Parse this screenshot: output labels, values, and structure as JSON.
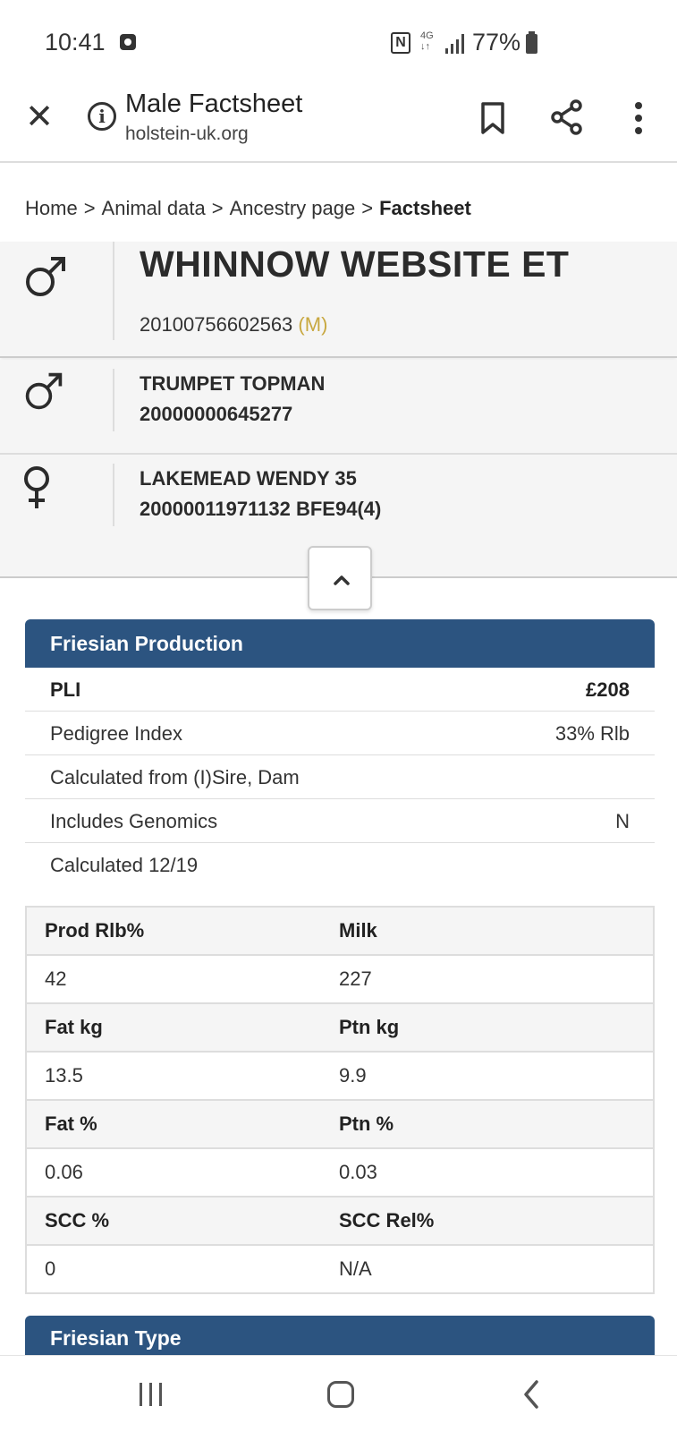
{
  "status_bar": {
    "time": "10:41",
    "network": "4G",
    "battery": "77%",
    "icons": [
      "app-notification-icon",
      "nfc-icon",
      "signal-icon",
      "battery-icon"
    ]
  },
  "browser": {
    "title": "Male Factsheet",
    "url": "holstein-uk.org",
    "icons": [
      "close-icon",
      "info-icon",
      "bookmark-icon",
      "share-icon",
      "more-vertical-icon"
    ]
  },
  "breadcrumb": {
    "items": [
      "Home",
      "Animal data",
      "Ancestry page"
    ],
    "current": "Factsheet",
    "separator": ">"
  },
  "animal": {
    "name": "WHINNOW WEBSITE ET",
    "id": "20100756602563",
    "sex_code": "(M)",
    "sex_icon": "male-icon"
  },
  "parents": {
    "sire": {
      "name": "TRUMPET TOPMAN",
      "id_line": "20000000645277",
      "icon": "male-icon"
    },
    "dam": {
      "name": "LAKEMEAD WENDY 35",
      "id_line": "20000011971132 BFE94(4)",
      "icon": "female-icon"
    }
  },
  "collapse_icon": "chevron-up-icon",
  "production": {
    "title": "Friesian Production",
    "rows": [
      {
        "label": "PLI",
        "value": "£208",
        "bold": true
      },
      {
        "label": "Pedigree Index",
        "value": "33% Rlb"
      },
      {
        "label": "Calculated from (I)Sire, Dam",
        "value": ""
      },
      {
        "label": "Includes Genomics",
        "value": "N"
      },
      {
        "label": "Calculated 12/19",
        "value": ""
      }
    ],
    "table": [
      {
        "h1": "Prod Rlb%",
        "h2": "Milk",
        "v1": "42",
        "v2": "227"
      },
      {
        "h1": "Fat kg",
        "h2": "Ptn kg",
        "v1": "13.5",
        "v2": "9.9"
      },
      {
        "h1": "Fat %",
        "h2": "Ptn %",
        "v1": "0.06",
        "v2": "0.03"
      },
      {
        "h1": "SCC %",
        "h2": "SCC Rel%",
        "v1": "0",
        "v2": "N/A"
      }
    ],
    "na_color": "#cc1111"
  },
  "type_panel": {
    "title": "Friesian Type"
  },
  "colors": {
    "panel_header": "#2c5480",
    "sex_code": "#c8a840"
  },
  "nav_bar": {
    "icons": [
      "recent-apps-icon",
      "home-icon",
      "back-icon"
    ]
  }
}
